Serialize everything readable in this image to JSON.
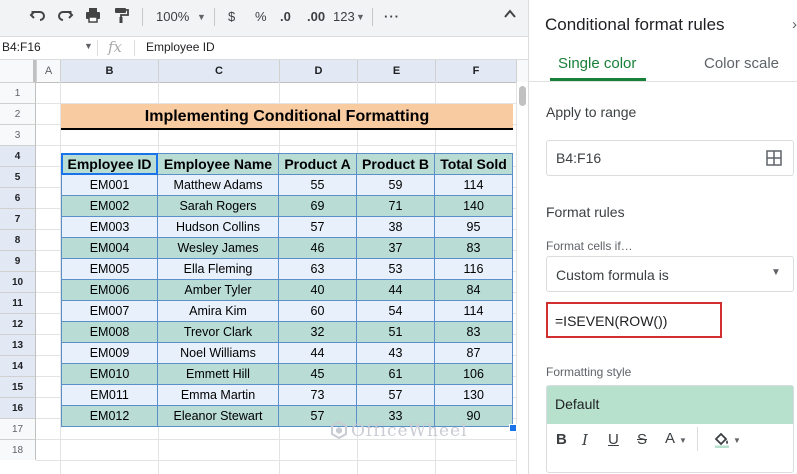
{
  "toolbar": {
    "undo_icon": "undo-icon",
    "redo_icon": "redo-icon",
    "print_icon": "print-icon",
    "paint_format_icon": "paint-format-icon",
    "zoom": "100%",
    "currency": "$",
    "percent": "%",
    "decrease_decimal": ".0",
    "increase_decimal": ".00",
    "more_formats": "123",
    "more_icon": "more-horiz-icon",
    "collapse_icon": "chevron-up-icon"
  },
  "formula_bar": {
    "name_box": "B4:F16",
    "fx": "fx",
    "value": "Employee ID"
  },
  "columns": [
    "A",
    "B",
    "C",
    "D",
    "E",
    "F"
  ],
  "rows": [
    "1",
    "2",
    "3",
    "4",
    "5",
    "6",
    "7",
    "8",
    "9",
    "10",
    "11",
    "12",
    "13",
    "14",
    "15",
    "16",
    "17",
    "18"
  ],
  "sheet": {
    "title": "Implementing Conditional Formatting",
    "headers": [
      "Employee ID",
      "Employee Name",
      "Product A",
      "Product B",
      "Total Sold"
    ],
    "data": [
      [
        "EM001",
        "Matthew Adams",
        "55",
        "59",
        "114"
      ],
      [
        "EM002",
        "Sarah Rogers",
        "69",
        "71",
        "140"
      ],
      [
        "EM003",
        "Hudson Collins",
        "57",
        "38",
        "95"
      ],
      [
        "EM004",
        "Wesley James",
        "46",
        "37",
        "83"
      ],
      [
        "EM005",
        "Ella Fleming",
        "63",
        "53",
        "116"
      ],
      [
        "EM006",
        "Amber Tyler",
        "40",
        "44",
        "84"
      ],
      [
        "EM007",
        "Amira Kim",
        "60",
        "54",
        "114"
      ],
      [
        "EM008",
        "Trevor Clark",
        "32",
        "51",
        "83"
      ],
      [
        "EM009",
        "Noel Williams",
        "44",
        "43",
        "87"
      ],
      [
        "EM010",
        "Emmett Hill",
        "45",
        "61",
        "106"
      ],
      [
        "EM011",
        "Emma Martin",
        "73",
        "57",
        "130"
      ],
      [
        "EM012",
        "Eleanor Stewart",
        "57",
        "33",
        "90"
      ]
    ]
  },
  "watermark": "OfficeWheel",
  "panel": {
    "title": "Conditional format rules",
    "tabs": [
      "Single color",
      "Color scale"
    ],
    "apply_label": "Apply to range",
    "range": "B4:F16",
    "format_rules_label": "Format rules",
    "format_cells_if": "Format cells if…",
    "condition": "Custom formula is",
    "formula": "=ISEVEN(ROW())",
    "formatting_style_label": "Formatting style",
    "style_preview": "Default",
    "colors": {
      "accent": "#188038",
      "highlight_border": "#d32f2f",
      "style_preview_bg": "#b7e1cd"
    }
  }
}
